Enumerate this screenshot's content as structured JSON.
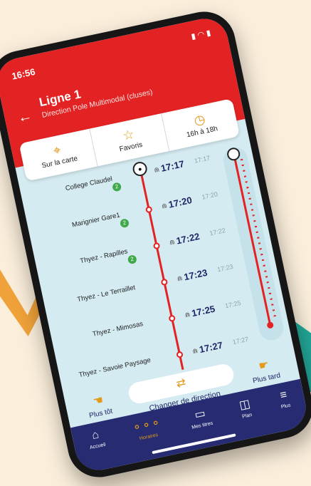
{
  "status_bar": {
    "time": "16:56",
    "icons": "▮ ◠ ▮"
  },
  "header": {
    "title": "Ligne 1",
    "direction": "Direction Pole Multimodal (cluses)"
  },
  "actions": [
    {
      "label": "Sur la carte",
      "icon": "map-pin-route-icon"
    },
    {
      "label": "Favoris",
      "icon": "star-icon"
    },
    {
      "label": "16h à 18h",
      "icon": "clock-icon"
    }
  ],
  "stops": [
    {
      "name": "College Claudel",
      "badge": "2",
      "realtime": "17:17",
      "scheduled": "17:17"
    },
    {
      "name": "Marignier Gare1",
      "badge": "2",
      "realtime": "17:20",
      "scheduled": "17:20"
    },
    {
      "name": "Thyez - Rapilles",
      "badge": "2",
      "realtime": "17:22",
      "scheduled": "17:22"
    },
    {
      "name": "Thyez - Le Terraillet",
      "badge": "",
      "realtime": "17:23",
      "scheduled": "17:23"
    },
    {
      "name": "Thyez - Mimosas",
      "badge": "",
      "realtime": "17:25",
      "scheduled": "17:25"
    },
    {
      "name": "Thyez - Savoie Paysage",
      "badge": "",
      "realtime": "17:27",
      "scheduled": "17:27"
    }
  ],
  "controls": {
    "earlier": "Plus tôt",
    "later": "Plus tard",
    "change_direction": "Changer de direction"
  },
  "tabs": [
    {
      "label": "Accueil",
      "icon": "home-icon",
      "active": false
    },
    {
      "label": "Horaires",
      "icon": "schedule-icon",
      "active": true
    },
    {
      "label": "Mes titres",
      "icon": "ticket-icon",
      "active": false
    },
    {
      "label": "Plan",
      "icon": "map-icon",
      "active": false
    },
    {
      "label": "Plus",
      "icon": "menu-icon",
      "active": false
    }
  ],
  "colors": {
    "brand_red": "#e32323",
    "accent_orange": "#e39a17",
    "nav_blue": "#262b72",
    "timeline_bg": "#d4ebf1"
  }
}
